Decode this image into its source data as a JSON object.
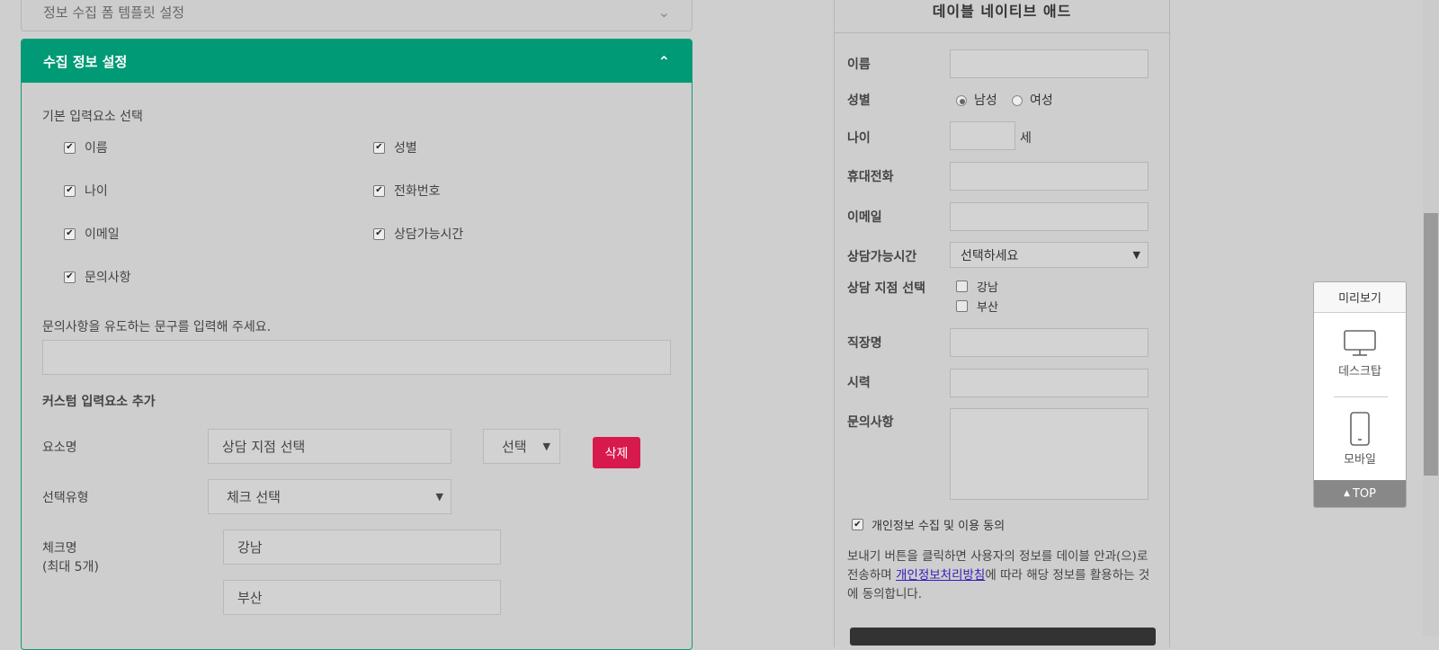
{
  "top_accordion": {
    "title": "정보 수집 폼 템플릿 설정"
  },
  "section": {
    "title": "수집 정보 설정",
    "basic_label": "기본 입력요소 선택",
    "checkboxes": [
      "이름",
      "성별",
      "나이",
      "전화번호",
      "이메일",
      "상담가능시간",
      "문의사항"
    ],
    "guide_label": "문의사항을 유도하는 문구를 입력해 주세요.",
    "guide_value": "",
    "custom_label": "커스텀 입력요소 추가",
    "element_name_label": "요소명",
    "element_name_value": "상담 지점 선택",
    "element_select_value": "선택",
    "delete_label": "삭제",
    "select_type_label": "선택유형",
    "select_type_value": "체크 선택",
    "check_name_label": "체크명",
    "check_name_hint": "(최대 5개)",
    "check_items": [
      "강남",
      "부산"
    ]
  },
  "preview": {
    "title": "데이블 네이티브 애드",
    "name_label": "이름",
    "gender_label": "성별",
    "gender_options": [
      "남성",
      "여성"
    ],
    "age_label": "나이",
    "age_unit": "세",
    "phone_label": "휴대전화",
    "email_label": "이메일",
    "time_label": "상담가능시간",
    "time_select": "선택하세요",
    "branch_label": "상담 지점 선택",
    "branch_options": [
      "강남",
      "부산"
    ],
    "company_label": "직장명",
    "vision_label": "시력",
    "inquiry_label": "문의사항",
    "consent_label": "개인정보 수집 및 이용 동의",
    "notice_before": "보내기 버튼을 클릭하면 사용자의 정보를 데이블 안과(으)로 전송하며 ",
    "notice_link": "개인정보처리방침",
    "notice_after": "에 따라 해당 정보를 활용하는 것에 동의합니다."
  },
  "widget": {
    "title": "미리보기",
    "desktop": "데스크탑",
    "mobile": "모바일",
    "top": "TOP"
  }
}
